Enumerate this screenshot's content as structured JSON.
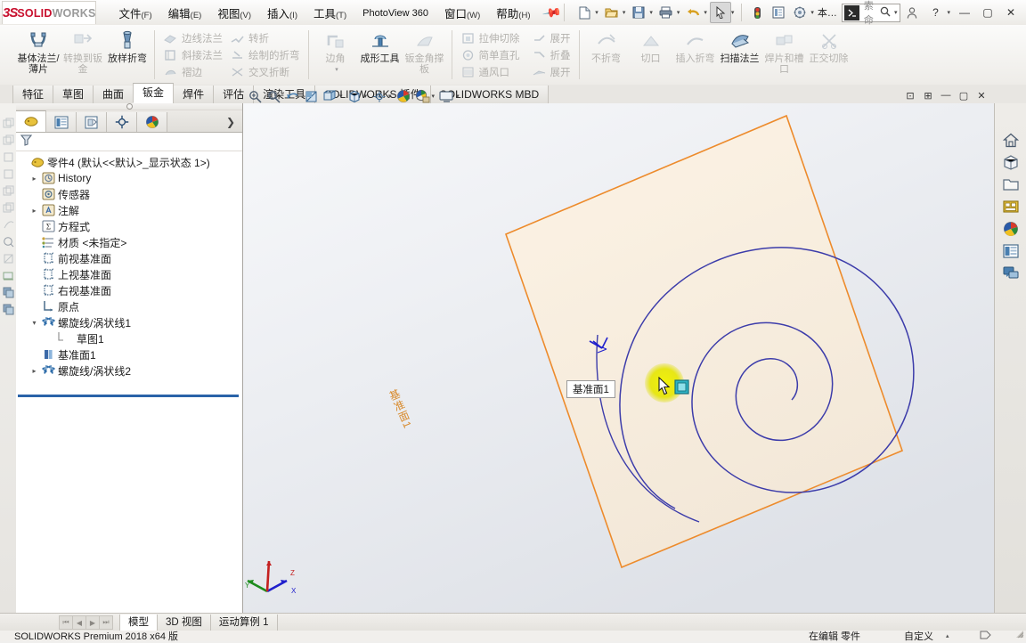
{
  "app": {
    "logo_ds": "3S",
    "logo_name": "SOLID",
    "logo_name_light": "WORKS",
    "product": "SOLIDWORKS Premium 2018 x64 版"
  },
  "menubar": {
    "items": [
      {
        "label": "文件",
        "mnemonic": "(F)"
      },
      {
        "label": "编辑",
        "mnemonic": "(E)"
      },
      {
        "label": "视图",
        "mnemonic": "(V)"
      },
      {
        "label": "插入",
        "mnemonic": "(I)"
      },
      {
        "label": "工具",
        "mnemonic": "(T)"
      },
      {
        "label": "PhotoView 360",
        "mnemonic": ""
      },
      {
        "label": "窗口",
        "mnemonic": "(W)"
      },
      {
        "label": "帮助",
        "mnemonic": "(H)"
      }
    ],
    "pin_icon": "pushpin-icon"
  },
  "quickbar": {
    "buttons": [
      {
        "name": "new-document",
        "icon": "new-file-icon",
        "dropdown": true
      },
      {
        "name": "open-document",
        "icon": "open-folder-icon",
        "dropdown": true
      },
      {
        "name": "save-document",
        "icon": "save-disk-icon",
        "dropdown": true
      },
      {
        "name": "print-document",
        "icon": "printer-icon",
        "dropdown": true
      },
      {
        "name": "undo",
        "icon": "undo-arrow-icon",
        "dropdown": true
      },
      {
        "name": "select",
        "icon": "cursor-arrow-icon",
        "dropdown": true
      },
      {
        "name": "rebuild",
        "icon": "rebuild-traffic-icon",
        "dropdown": false
      },
      {
        "name": "options",
        "icon": "options-gear-icon",
        "dropdown": false
      },
      {
        "name": "settings",
        "icon": "settings-icon",
        "dropdown": true
      },
      {
        "name": "more-commands",
        "icon": "more-icon",
        "dropdown": false
      }
    ]
  },
  "search": {
    "placeholder": "搜索命令",
    "icon": "search-command-icon",
    "magnifier": "magnifier-icon"
  },
  "window_controls": {
    "account": "user-account-icon",
    "help": "?",
    "help_caret": "▾",
    "minimize": "—",
    "maximize": "▢",
    "close": "✕"
  },
  "ribbon": {
    "groups": [
      {
        "name": "base-flange-group",
        "big_buttons": [
          {
            "label": "基体法兰/薄片",
            "icon": "base-flange-icon",
            "enabled": true
          },
          {
            "label": "转换到钣金",
            "icon": "convert-sheetmetal-icon",
            "enabled": false
          },
          {
            "label": "放样折弯",
            "icon": "lofted-bend-icon",
            "enabled": true
          }
        ]
      },
      {
        "name": "flange-small-group",
        "columns": [
          [
            {
              "label": "边线法兰",
              "icon": "edge-flange-icon"
            },
            {
              "label": "斜接法兰",
              "icon": "miter-flange-icon"
            },
            {
              "label": "褶边",
              "icon": "hem-icon"
            }
          ],
          [
            {
              "label": "转折",
              "icon": "jog-icon"
            },
            {
              "label": "绘制的折弯",
              "icon": "sketched-bend-icon"
            },
            {
              "label": "交叉折断",
              "icon": "cross-break-icon"
            }
          ]
        ]
      },
      {
        "name": "corner-group",
        "big_buttons": [
          {
            "label": "边角",
            "icon": "corner-icon",
            "enabled": false,
            "dropdown": true
          },
          {
            "label": "成形工具",
            "icon": "forming-tool-icon",
            "enabled": true
          },
          {
            "label": "钣金角撑板",
            "icon": "sheetmetal-gusset-icon",
            "enabled": false
          }
        ]
      },
      {
        "name": "cut-group",
        "columns": [
          [
            {
              "label": "拉伸切除",
              "icon": "extruded-cut-icon"
            },
            {
              "label": "简单直孔",
              "icon": "simple-hole-icon"
            },
            {
              "label": "通风口",
              "icon": "vent-icon"
            }
          ],
          [
            {
              "label": "展开",
              "icon": "unfold-icon"
            },
            {
              "label": "折叠",
              "icon": "fold-icon"
            },
            {
              "label": "展开",
              "icon": "flatten-icon"
            }
          ]
        ]
      },
      {
        "name": "nobend-group",
        "big_buttons": [
          {
            "label": "不折弯",
            "icon": "no-bends-icon",
            "enabled": false
          },
          {
            "label": "切口",
            "icon": "rip-icon",
            "enabled": false
          },
          {
            "label": "插入折弯",
            "icon": "insert-bends-icon",
            "enabled": false
          },
          {
            "label": "扫描法兰",
            "icon": "swept-flange-icon",
            "enabled": true
          },
          {
            "label": "焊片和槽口",
            "icon": "tab-and-slot-icon",
            "enabled": false
          },
          {
            "label": "正交切除",
            "icon": "normal-cut-icon",
            "enabled": false
          }
        ]
      }
    ]
  },
  "command_tabs": {
    "items": [
      {
        "label": "特征",
        "active": false
      },
      {
        "label": "草图",
        "active": false
      },
      {
        "label": "曲面",
        "active": false
      },
      {
        "label": "钣金",
        "active": true
      },
      {
        "label": "焊件",
        "active": false
      },
      {
        "label": "评估",
        "active": false
      },
      {
        "label": "渲染工具",
        "active": false
      },
      {
        "label": "SOLIDWORKS 插件",
        "active": false
      },
      {
        "label": "SOLIDWORKS MBD",
        "active": false
      }
    ]
  },
  "feature_manager": {
    "tabs": [
      {
        "name": "feature-tree-tab",
        "icon": "feature-tree-icon",
        "active": true
      },
      {
        "name": "property-manager-tab",
        "icon": "property-manager-icon",
        "active": false
      },
      {
        "name": "configuration-manager-tab",
        "icon": "configuration-icon",
        "active": false
      },
      {
        "name": "dimxpert-manager-tab",
        "icon": "dimxpert-icon",
        "active": false
      },
      {
        "name": "display-manager-tab",
        "icon": "display-manager-icon",
        "active": false
      }
    ],
    "more_caret": "❯",
    "filter_icon": "filter-funnel-icon",
    "tree": [
      {
        "label": "零件4  (默认<<默认>_显示状态 1>)",
        "icon": "part-icon",
        "indent": 0,
        "expand": "",
        "selected": false
      },
      {
        "label": "History",
        "icon": "history-icon",
        "indent": 1,
        "expand": "▸",
        "selected": false
      },
      {
        "label": "传感器",
        "icon": "sensor-icon",
        "indent": 1,
        "expand": "",
        "selected": false
      },
      {
        "label": "注解",
        "icon": "annotation-icon",
        "indent": 1,
        "expand": "▸",
        "selected": false
      },
      {
        "label": "方程式",
        "icon": "equation-icon",
        "indent": 1,
        "expand": "",
        "selected": false
      },
      {
        "label": "材质 <未指定>",
        "icon": "material-icon",
        "indent": 1,
        "expand": "",
        "selected": false
      },
      {
        "label": "前视基准面",
        "icon": "plane-icon",
        "indent": 1,
        "expand": "",
        "selected": false
      },
      {
        "label": "上视基准面",
        "icon": "plane-icon",
        "indent": 1,
        "expand": "",
        "selected": false
      },
      {
        "label": "右视基准面",
        "icon": "plane-icon",
        "indent": 1,
        "expand": "",
        "selected": false
      },
      {
        "label": "原点",
        "icon": "origin-icon",
        "indent": 1,
        "expand": "",
        "selected": false
      },
      {
        "label": "螺旋线/涡状线1",
        "icon": "helix-icon",
        "indent": 1,
        "expand": "▾",
        "selected": false
      },
      {
        "label": "草图1",
        "icon": "sketch-icon",
        "indent": 2,
        "expand": "",
        "selected": false
      },
      {
        "label": "基准面1",
        "icon": "refplane-icon",
        "indent": 1,
        "expand": "",
        "selected": false
      },
      {
        "label": "螺旋线/涡状线2",
        "icon": "helix-icon",
        "indent": 1,
        "expand": "▸",
        "selected": true
      }
    ]
  },
  "view_toolbar": {
    "buttons": [
      {
        "name": "zoom-to-fit-button",
        "icon": "zoom-fit-icon"
      },
      {
        "name": "zoom-to-area-button",
        "icon": "zoom-area-icon"
      },
      {
        "name": "previous-view-button",
        "icon": "previous-view-icon"
      },
      {
        "name": "section-view-button",
        "icon": "section-view-icon"
      },
      {
        "name": "view-orientation-button",
        "icon": "view-orientation-icon"
      },
      {
        "name": "display-style-button",
        "icon": "display-style-icon",
        "dropdown": true
      },
      {
        "name": "hide-show-items-button",
        "icon": "hide-show-icon",
        "dropdown": true
      },
      {
        "name": "edit-appearance-button",
        "icon": "appearance-icon",
        "dropdown": true
      },
      {
        "name": "apply-scene-button",
        "icon": "scene-icon",
        "dropdown": true
      },
      {
        "name": "view-settings-button",
        "icon": "view-settings-icon",
        "dropdown": true
      },
      {
        "name": "viewport-layout-button",
        "icon": "viewport-layout-icon",
        "dropdown": true
      }
    ],
    "window_buttons": [
      {
        "name": "restore-sub-window",
        "icon": "restore-icon",
        "glyph": "⊡"
      },
      {
        "name": "tile-sub-window",
        "icon": "tile-icon",
        "glyph": "⊞"
      },
      {
        "name": "minimize-sub-window",
        "icon": "minimize-icon",
        "glyph": "—"
      },
      {
        "name": "maximize-sub-window",
        "icon": "maximize-icon",
        "glyph": "▢"
      },
      {
        "name": "close-sub-window",
        "icon": "close-icon",
        "glyph": "✕"
      }
    ]
  },
  "task_pane": {
    "items": [
      {
        "name": "solidworks-resources",
        "icon": "home-icon"
      },
      {
        "name": "design-library",
        "icon": "design-library-icon"
      },
      {
        "name": "file-explorer",
        "icon": "file-explorer-icon"
      },
      {
        "name": "view-palette",
        "icon": "view-palette-icon"
      },
      {
        "name": "appearances-scenes",
        "icon": "appearances-icon"
      },
      {
        "name": "custom-properties",
        "icon": "custom-properties-icon"
      },
      {
        "name": "solidworks-forum",
        "icon": "forum-icon"
      }
    ]
  },
  "viewport": {
    "plane_label": "基准面1",
    "plane_edge_label": "基准面1",
    "colors": {
      "plane_border": "#ED8B2C",
      "plane_fill": "#FBEEDC",
      "curve": "#3C3CAA",
      "highlight": "#E8E80F",
      "selected_plane": "#1FA5B8"
    },
    "triad": {
      "x_label": "X",
      "y_label": "Y",
      "z_label": "Z",
      "x_color": "#2020CC",
      "y_color": "#1E8C1E",
      "z_color": "#C42020"
    }
  },
  "bottom_tabs": {
    "nav": [
      "⏮",
      "◀",
      "▶",
      "⏭"
    ],
    "items": [
      {
        "label": "模型",
        "active": true
      },
      {
        "label": "3D 视图",
        "active": false
      },
      {
        "label": "运动算例 1",
        "active": false
      }
    ]
  },
  "status_bar": {
    "product": "SOLIDWORKS Premium 2018 x64 版",
    "editing": "在编辑 零件",
    "custom": "自定义",
    "caret": "▴",
    "icon": "overlay-icon"
  }
}
